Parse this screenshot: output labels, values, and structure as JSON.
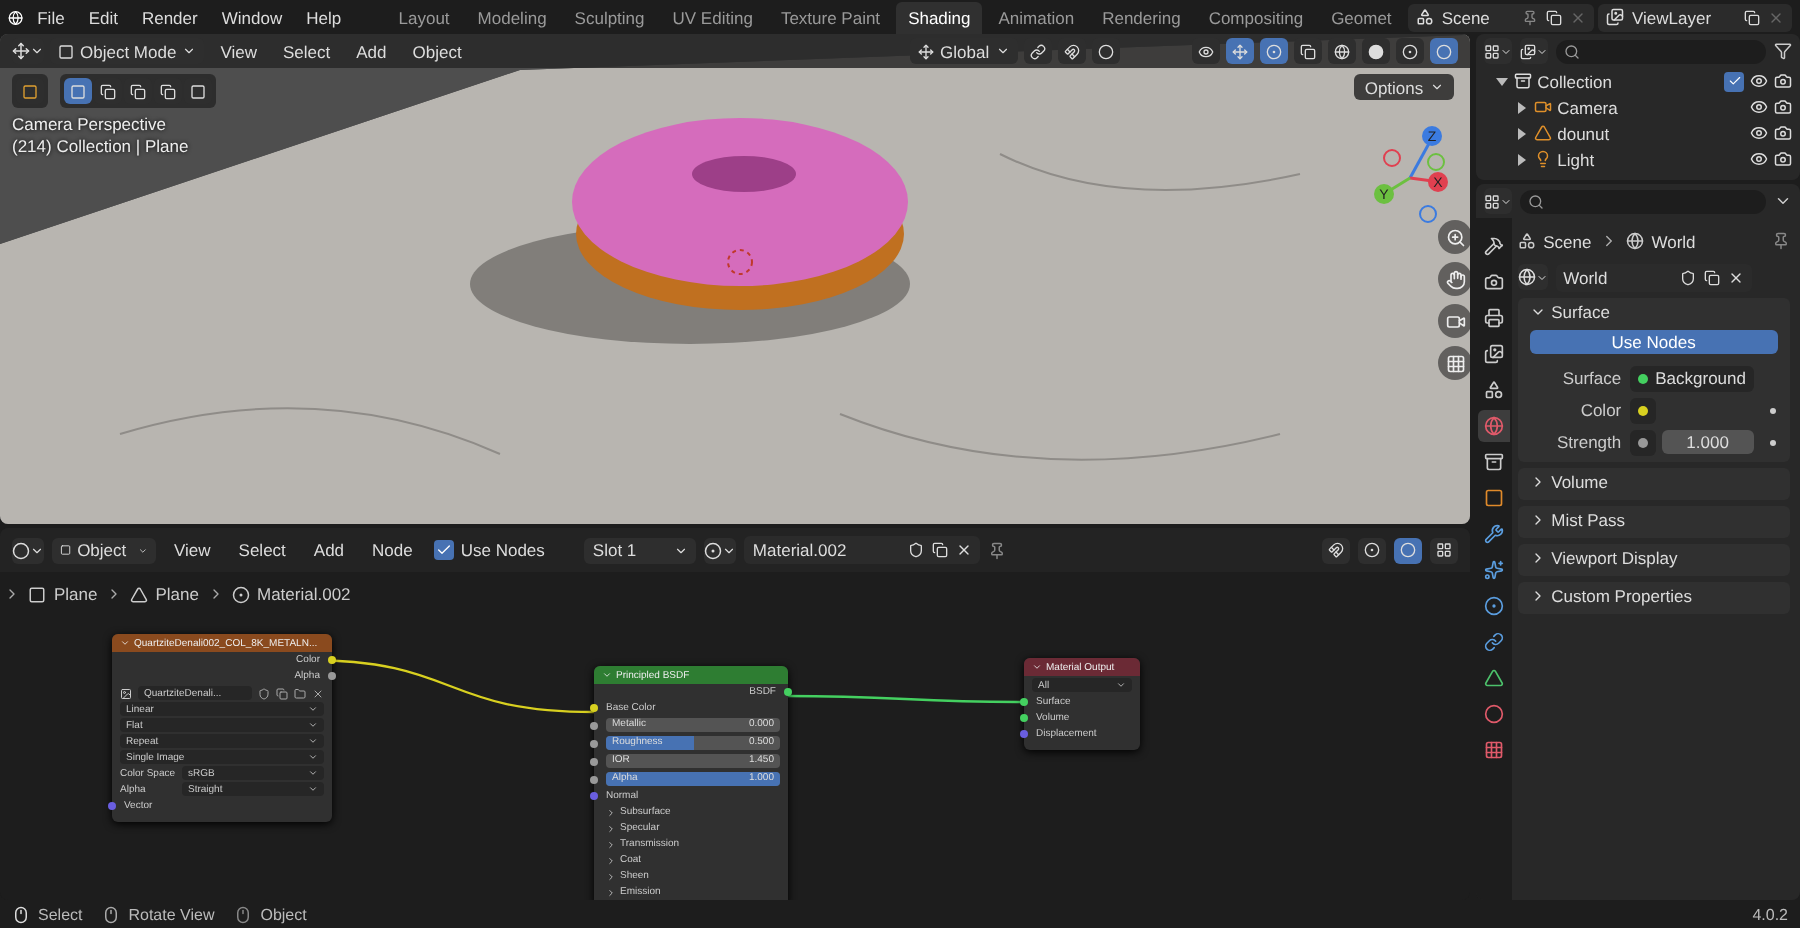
{
  "menu_bar": {
    "menus": [
      "File",
      "Edit",
      "Render",
      "Window",
      "Help"
    ]
  },
  "workspaces": [
    {
      "label": "Layout",
      "selected": false
    },
    {
      "label": "Modeling",
      "selected": false
    },
    {
      "label": "Sculpting",
      "selected": false
    },
    {
      "label": "UV Editing",
      "selected": false
    },
    {
      "label": "Texture Paint",
      "selected": false
    },
    {
      "label": "Shading",
      "selected": true
    },
    {
      "label": "Animation",
      "selected": false
    },
    {
      "label": "Rendering",
      "selected": false
    },
    {
      "label": "Compositing",
      "selected": false
    },
    {
      "label": "Geomet",
      "selected": false
    }
  ],
  "scene": "Scene",
  "view_layer": "ViewLayer",
  "viewport": {
    "mode": "Object Mode",
    "menus": [
      "View",
      "Select",
      "Add",
      "Object"
    ],
    "orientation": "Global",
    "overlay_texts": [
      "Camera Perspective",
      "(214) Collection | Plane"
    ],
    "options": "Options",
    "gizmo_axes": [
      "X",
      "Y",
      "Z"
    ]
  },
  "outliner": {
    "items": [
      {
        "name": "Collection",
        "kind": "collection",
        "expanded": true,
        "checked": true,
        "children": [
          {
            "name": "Camera",
            "kind": "camera",
            "expanded": false
          },
          {
            "name": "dounut",
            "kind": "mesh",
            "expanded": false
          },
          {
            "name": "Light",
            "kind": "light",
            "expanded": false
          }
        ]
      }
    ]
  },
  "properties": {
    "tabs": [
      {
        "kind": "tool",
        "selected": false
      },
      {
        "kind": "render",
        "selected": false
      },
      {
        "kind": "output",
        "selected": false
      },
      {
        "kind": "view_layer",
        "selected": false
      },
      {
        "kind": "scene",
        "selected": false
      },
      {
        "kind": "world",
        "selected": true
      },
      {
        "kind": "collection",
        "selected": false
      },
      {
        "kind": "object",
        "selected": false
      },
      {
        "kind": "modifier",
        "selected": false
      },
      {
        "kind": "particles",
        "selected": false
      },
      {
        "kind": "physics",
        "selected": false
      },
      {
        "kind": "constraints",
        "selected": false
      },
      {
        "kind": "data",
        "selected": false
      },
      {
        "kind": "material",
        "selected": false
      },
      {
        "kind": "texture",
        "selected": false
      }
    ],
    "breadcrumb": [
      "Scene",
      "World"
    ],
    "datablock": "World",
    "panels": [
      {
        "title": "Surface",
        "expanded": true
      },
      {
        "title": "Volume",
        "expanded": false
      },
      {
        "title": "Mist Pass",
        "expanded": false
      },
      {
        "title": "Viewport Display",
        "expanded": false
      },
      {
        "title": "Custom Properties",
        "expanded": false
      }
    ],
    "use_nodes": "Use Nodes",
    "fields": [
      {
        "label": "Surface",
        "value": "Background",
        "kind": "link"
      },
      {
        "label": "Color",
        "kind": "color"
      },
      {
        "label": "Strength",
        "value": "1.000",
        "kind": "number"
      }
    ]
  },
  "node_editor": {
    "type": "Object",
    "menus": [
      "View",
      "Select",
      "Add",
      "Node"
    ],
    "use_nodes": {
      "label": "Use Nodes",
      "checked": true
    },
    "slot": "Slot 1",
    "material": "Material.002",
    "breadcrumb": [
      "Plane",
      "Plane",
      "Material.002"
    ],
    "image_texture_node": {
      "title": "QuartziteDenali002_COL_8K_METALN...",
      "outputs": [
        "Color",
        "Alpha"
      ],
      "image": "QuartziteDenali...",
      "dropdowns": [
        "Linear",
        "Flat",
        "Repeat",
        "Single Image"
      ],
      "props": [
        {
          "label": "Color Space",
          "value": "sRGB"
        },
        {
          "label": "Alpha",
          "value": "Straight"
        }
      ],
      "inputs": [
        "Vector"
      ]
    },
    "bsdf_node": {
      "title": "Principled BSDF",
      "output": "BSDF",
      "base_color": "Base Color",
      "sliders": [
        {
          "label": "Metallic",
          "value": "0.000",
          "level": 0
        },
        {
          "label": "Roughness",
          "value": "0.500",
          "level": 0.5
        },
        {
          "label": "IOR",
          "value": "1.450",
          "level": 0
        },
        {
          "label": "Alpha",
          "value": "1.000",
          "level": 1
        }
      ],
      "normal": "Normal",
      "panels": [
        "Subsurface",
        "Specular",
        "Transmission",
        "Coat",
        "Sheen",
        "Emission"
      ]
    },
    "output_node": {
      "title": "Material Output",
      "target": "All",
      "inputs": [
        "Surface",
        "Volume",
        "Displacement"
      ]
    }
  },
  "status_bar": {
    "items": [
      {
        "label": "Select",
        "kind": "left"
      },
      {
        "label": "Rotate View",
        "kind": "middle"
      },
      {
        "label": "Object",
        "kind": "right"
      }
    ],
    "version": "4.0.2"
  }
}
